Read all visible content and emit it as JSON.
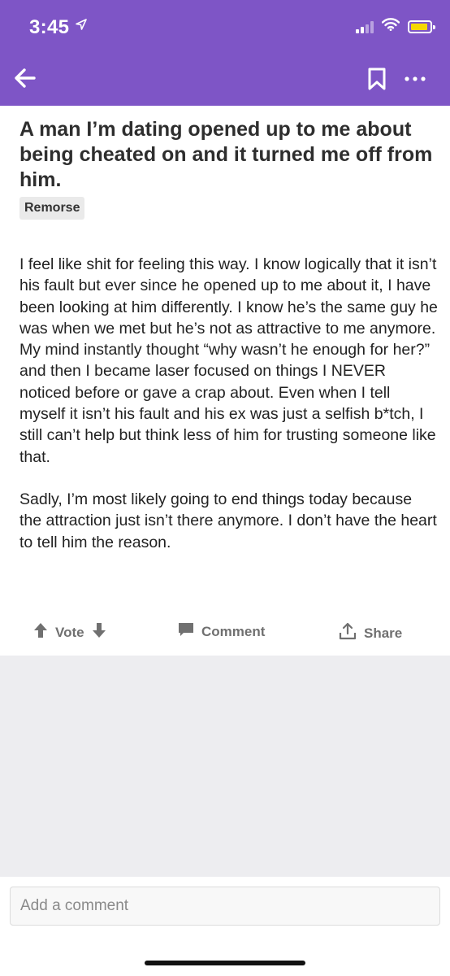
{
  "status_bar": {
    "time": "3:45",
    "location_icon": "location-arrow-icon",
    "signal_icon": "cellular-signal-icon",
    "wifi_icon": "wifi-icon",
    "battery_icon": "battery-icon",
    "battery_color": "#f5d800"
  },
  "header": {
    "background_color": "#7e55c6",
    "back_icon": "back-arrow-icon",
    "bookmark_icon": "bookmark-icon",
    "more_icon": "more-dots-icon"
  },
  "post": {
    "title": "A man I’m dating opened up to me about being cheated on and it turned me off from him.",
    "tag": "Remorse",
    "paragraphs": [
      "I feel like shit for feeling this way. I know logically that it isn’t his fault but ever since he opened up to me about it, I have been looking at him differently. I know he’s the same guy he was when we met but he’s not as attractive to me anymore. My mind instantly thought “why wasn’t he enough for her?” and then I became laser focused on things I NEVER noticed before or gave a crap about. Even when I tell myself it isn’t his fault and his ex was just a selfish b*tch, I still can’t help but think less of him for trusting someone like that.",
      "Sadly, I’m most likely going to end things today because the attraction just isn’t there anymore. I don’t have the heart to tell him the reason."
    ]
  },
  "actions": {
    "vote_label": "Vote",
    "comment_label": "Comment",
    "share_label": "Share"
  },
  "comment_box": {
    "placeholder": "Add a comment"
  }
}
